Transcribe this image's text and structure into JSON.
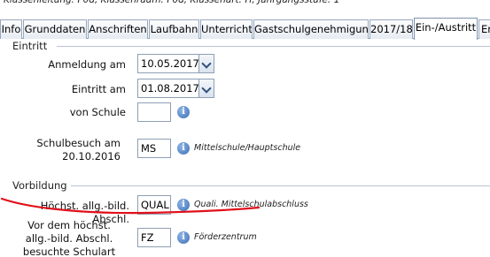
{
  "header": {
    "text": "Klassenleitung: F0d, Klassenraum: F0d, Klassenart: H, Jahrgangsstufe: 1"
  },
  "tabs": [
    {
      "label": "Info"
    },
    {
      "label": "Grunddaten"
    },
    {
      "label": "Anschriften"
    },
    {
      "label": "Laufbahn"
    },
    {
      "label": "Unterricht"
    },
    {
      "label": "Gastschulgenehmigung"
    },
    {
      "label": "2017/18"
    },
    {
      "label": "Ein-/Austritt"
    },
    {
      "label": "En"
    }
  ],
  "eintritt": {
    "title": "Eintritt",
    "anmeldung": {
      "label": "Anmeldung am",
      "value": "10.05.2017"
    },
    "eintritt_am": {
      "label": "Eintritt am",
      "value": "01.08.2017"
    },
    "von_schule": {
      "label": "von Schule",
      "value": ""
    },
    "schulbesuch": {
      "label_line1": "Schulbesuch am",
      "label_line2": "20.10.2016",
      "value": "MS",
      "hint": "Mittelschule/Hauptschule"
    }
  },
  "vorbildung": {
    "title": "Vorbildung",
    "abschluss": {
      "label": "Höchst. allg.-bild. Abschl.",
      "value": "QUAL",
      "hint": "Quali. Mittelschulabschluss"
    },
    "schulart": {
      "label_line1": "Vor dem höchst.",
      "label_line2": "allg.-bild. Abschl.",
      "label_line3": "besuchte Schulart",
      "value": "FZ",
      "hint": "Förderzentrum"
    }
  },
  "colors": {
    "annotation_red": "#e0101a",
    "tab_border": "#98a8be",
    "info_blue": "#3b6eb4"
  }
}
